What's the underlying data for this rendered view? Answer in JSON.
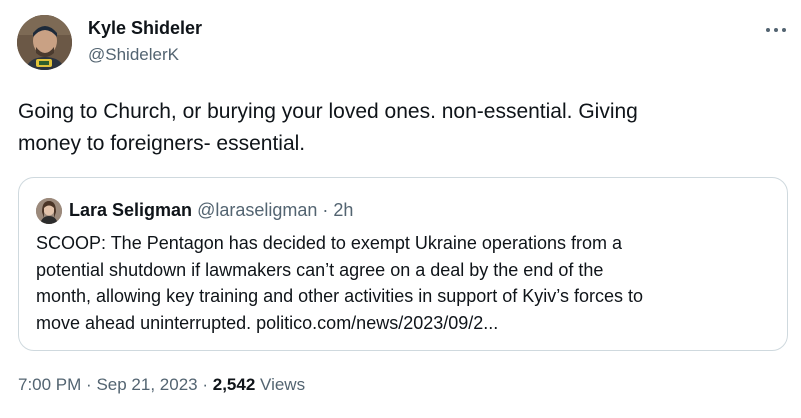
{
  "author": {
    "name": "Kyle Shideler",
    "handle": "@ShidelerK"
  },
  "tweet": {
    "line1": "Going to Church, or burying your loved ones. non-essential. Giving",
    "line2": "money to foreigners- essential."
  },
  "quote": {
    "name": "Lara Seligman",
    "handle": "@laraseligman",
    "separator": "·",
    "time": "2h",
    "lines": [
      "SCOOP: The Pentagon has decided to exempt Ukraine operations from a",
      "potential shutdown if lawmakers can’t agree on a deal by the end of the",
      "month, allowing key training and other activities in support of Kyiv’s forces to",
      "move ahead uninterrupted. politico.com/news/2023/09/2..."
    ]
  },
  "meta": {
    "time": "7:00 PM",
    "date": "Sep 21, 2023",
    "separator": "·",
    "views_count": "2,542",
    "views_label": "Views"
  },
  "icons": {
    "more": "more-horizontal-icon"
  },
  "colors": {
    "text_primary": "#0f1419",
    "text_secondary": "#536471",
    "border": "#cfd9de"
  }
}
